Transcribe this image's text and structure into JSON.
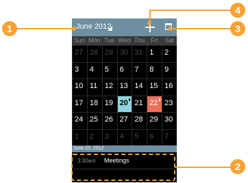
{
  "header": {
    "month_label": "June 2012"
  },
  "weekdays": [
    "Sun",
    "Mon",
    "Tue",
    "Wed",
    "Thu",
    "Fri",
    "Sat"
  ],
  "calendar": [
    [
      {
        "d": "27",
        "dim": true
      },
      {
        "d": "28",
        "dim": true
      },
      {
        "d": "29",
        "dim": true
      },
      {
        "d": "30",
        "dim": true
      },
      {
        "d": "31",
        "dim": true
      },
      {
        "d": "1"
      },
      {
        "d": "2"
      }
    ],
    [
      {
        "d": "3"
      },
      {
        "d": "4"
      },
      {
        "d": "5"
      },
      {
        "d": "6"
      },
      {
        "d": "7"
      },
      {
        "d": "8"
      },
      {
        "d": "9"
      }
    ],
    [
      {
        "d": "10"
      },
      {
        "d": "11"
      },
      {
        "d": "12"
      },
      {
        "d": "13"
      },
      {
        "d": "14"
      },
      {
        "d": "15"
      },
      {
        "d": "16"
      }
    ],
    [
      {
        "d": "17"
      },
      {
        "d": "18"
      },
      {
        "d": "19"
      },
      {
        "d": "20",
        "today": true,
        "event": true
      },
      {
        "d": "21"
      },
      {
        "d": "22",
        "selected": true,
        "event": true
      },
      {
        "d": "23"
      }
    ],
    [
      {
        "d": "24"
      },
      {
        "d": "25"
      },
      {
        "d": "26"
      },
      {
        "d": "27"
      },
      {
        "d": "28"
      },
      {
        "d": "29"
      },
      {
        "d": "30"
      }
    ],
    [
      {
        "d": "1",
        "dim": true
      },
      {
        "d": "2",
        "dim": true
      },
      {
        "d": "3",
        "dim": true
      },
      {
        "d": "4",
        "dim": true
      },
      {
        "d": "5",
        "dim": true
      },
      {
        "d": "6",
        "dim": true
      },
      {
        "d": "7",
        "dim": true
      }
    ]
  ],
  "events": {
    "date_header": "June 22, 2012",
    "items": [
      {
        "time": "3:30am",
        "title": "Meetings"
      }
    ]
  },
  "callouts": [
    "1",
    "2",
    "3",
    "4"
  ],
  "colors": {
    "accent": "#f7a233",
    "appbar": "#6f8fa0",
    "today": "#8ed6dd",
    "selected": "#ec6f5c"
  },
  "icons": {
    "add": "plus-icon",
    "today": "calendar-today-icon",
    "month": "dropdown-caret-icon"
  }
}
